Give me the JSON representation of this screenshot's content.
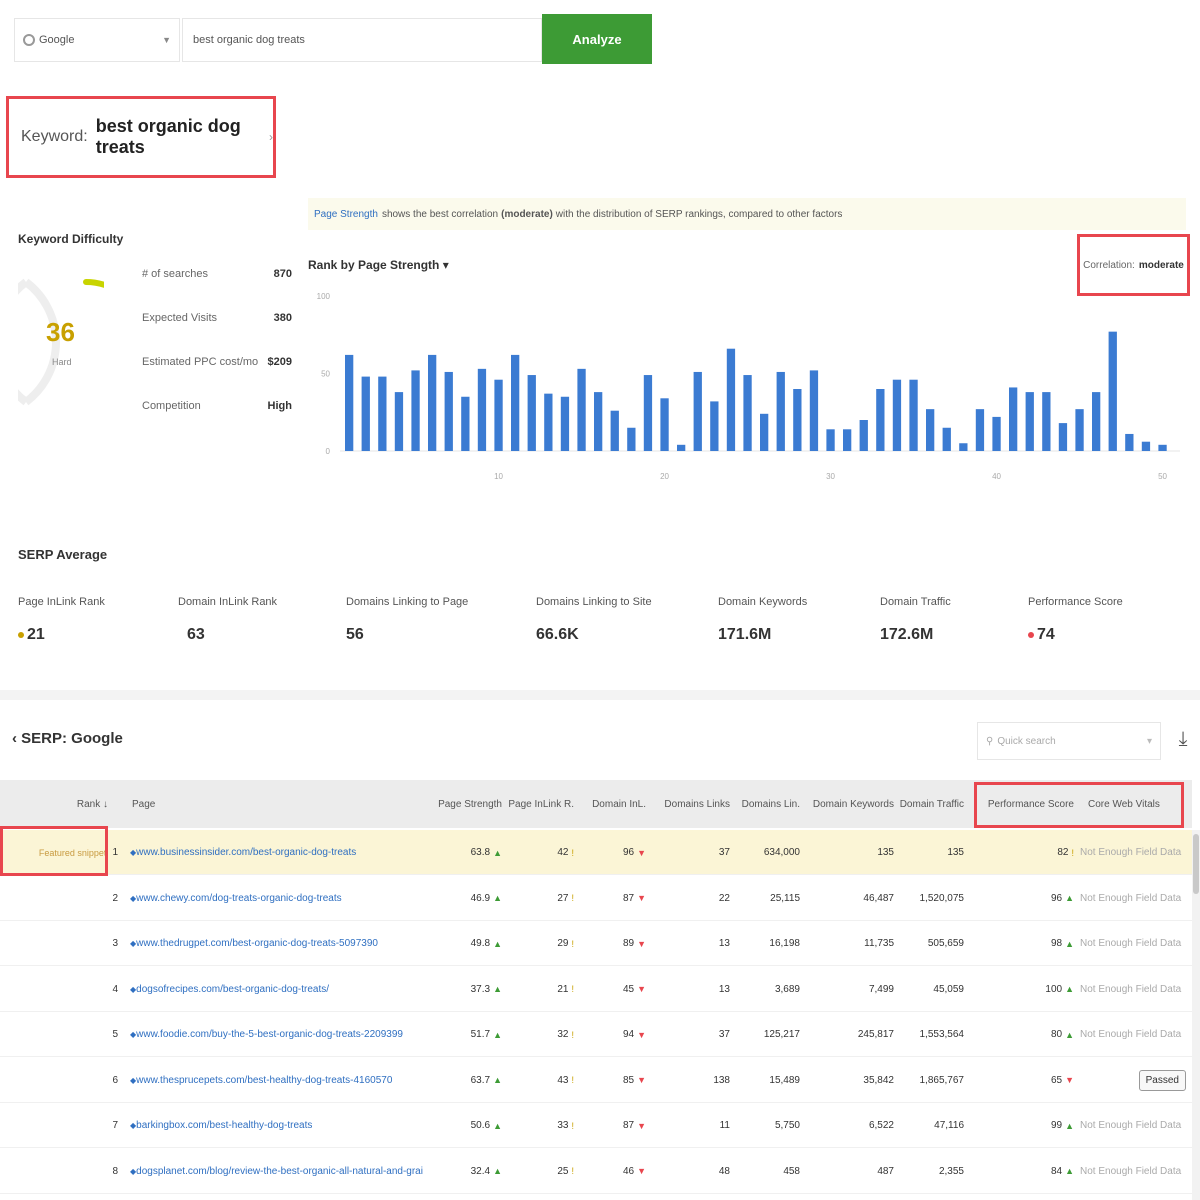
{
  "search": {
    "engine": "Google",
    "keyword_value": "best organic dog treats",
    "analyze_label": "Analyze"
  },
  "keyword": {
    "label": "Keyword:",
    "value": "best organic dog treats",
    "chevron": "›"
  },
  "difficulty": {
    "title": "Keyword Difficulty",
    "score": "36",
    "sublabel": "Hard",
    "score_fraction": 0.36,
    "metrics": [
      {
        "label": "# of searches",
        "value": "870"
      },
      {
        "label": "Expected Visits",
        "value": "380"
      },
      {
        "label": "Estimated PPC cost/mo",
        "value": "$209"
      },
      {
        "label": "Competition",
        "value": "High"
      }
    ]
  },
  "info": {
    "link": "Page Strength",
    "text_before": "shows the best correlation",
    "bold": "(moderate)",
    "text_after": "with the distribution of SERP rankings, compared to other factors"
  },
  "chart": {
    "title": "Rank by Page Strength",
    "title_caret": "▾",
    "correlation_label": "Correlation:",
    "correlation_value": "moderate"
  },
  "chart_data": {
    "type": "bar",
    "title": "Rank by Page Strength",
    "xlabel": "",
    "ylabel": "",
    "ylim": [
      0,
      100
    ],
    "yticks": [
      "100",
      "50",
      "0"
    ],
    "xticks": [
      "10",
      "20",
      "30",
      "40",
      "50"
    ],
    "bar_color": "#3b7bd2",
    "values": [
      62,
      48,
      48,
      38,
      52,
      62,
      51,
      35,
      53,
      46,
      62,
      49,
      37,
      35,
      53,
      38,
      26,
      15,
      49,
      34,
      4,
      51,
      32,
      66,
      49,
      24,
      51,
      40,
      52,
      14,
      14,
      20,
      40,
      46,
      46,
      27,
      15,
      5,
      27,
      22,
      41,
      38,
      38,
      18,
      27,
      38,
      77,
      11,
      6,
      4
    ]
  },
  "serp_average": {
    "title": "SERP Average",
    "items": [
      {
        "label": "Page InLink Rank",
        "value": "21",
        "dot": "#c8a000"
      },
      {
        "label": "Domain InLink Rank",
        "value": "63",
        "dot": ""
      },
      {
        "label": "Domains Linking to Page",
        "value": "56",
        "dot": ""
      },
      {
        "label": "Domains Linking to Site",
        "value": "66.6K",
        "dot": ""
      },
      {
        "label": "Domain Keywords",
        "value": "171.6M",
        "dot": ""
      },
      {
        "label": "Domain Traffic",
        "value": "172.6M",
        "dot": ""
      },
      {
        "label": "Performance Score",
        "value": "74",
        "dot": "#e8464e"
      }
    ]
  },
  "serp": {
    "title": "SERP: Google",
    "collapse_caret": "‹",
    "quick_search_placeholder": "Quick search",
    "columns": [
      "Rank",
      "Page",
      "Page Strength",
      "Page InLink R.",
      "Domain InL.",
      "Domains Links",
      "Domains Lin.",
      "Domain Keywords",
      "Domain Traffic",
      "Performance Score",
      "Core Web Vitals"
    ],
    "rows": [
      {
        "rank": "1",
        "rank_note": "Featured snippet",
        "page": "www.businessinsider.com/best-organic-dog-treats",
        "ps": "63.8",
        "ps_dir": "up",
        "pir": "42",
        "pir_dir": "warn",
        "dir": "96",
        "dir_dir": "down",
        "dl": "37",
        "dlin": "634,000",
        "dk": "135",
        "dt": "135",
        "perf": "82",
        "perf_dir": "warn",
        "cwv": "Not Enough Field Data",
        "cwv_type": "muted"
      },
      {
        "rank": "2",
        "rank_note": "",
        "page": "www.chewy.com/dog-treats-organic-dog-treats",
        "ps": "46.9",
        "ps_dir": "up",
        "pir": "27",
        "pir_dir": "warn",
        "dir": "87",
        "dir_dir": "down",
        "dl": "22",
        "dlin": "25,115",
        "dk": "46,487",
        "dt": "1,520,075",
        "perf": "96",
        "perf_dir": "up",
        "cwv": "Not Enough Field Data",
        "cwv_type": "muted"
      },
      {
        "rank": "3",
        "rank_note": "",
        "page": "www.thedrugpet.com/best-organic-dog-treats-5097390",
        "ps": "49.8",
        "ps_dir": "up",
        "pir": "29",
        "pir_dir": "warn",
        "dir": "89",
        "dir_dir": "down",
        "dl": "13",
        "dlin": "16,198",
        "dk": "11,735",
        "dt": "505,659",
        "perf": "98",
        "perf_dir": "up",
        "cwv": "Not Enough Field Data",
        "cwv_type": "muted"
      },
      {
        "rank": "4",
        "rank_note": "",
        "page": "dogsofrecipes.com/best-organic-dog-treats/",
        "ps": "37.3",
        "ps_dir": "up",
        "pir": "21",
        "pir_dir": "warn",
        "dir": "45",
        "dir_dir": "down",
        "dl": "13",
        "dlin": "3,689",
        "dk": "7,499",
        "dt": "45,059",
        "perf": "100",
        "perf_dir": "up",
        "cwv": "Not Enough Field Data",
        "cwv_type": "muted"
      },
      {
        "rank": "5",
        "rank_note": "",
        "page": "www.foodie.com/buy-the-5-best-organic-dog-treats-2209399",
        "ps": "51.7",
        "ps_dir": "up",
        "pir": "32",
        "pir_dir": "warn",
        "dir": "94",
        "dir_dir": "down",
        "dl": "37",
        "dlin": "125,217",
        "dk": "245,817",
        "dt": "1,553,564",
        "perf": "80",
        "perf_dir": "up",
        "cwv": "Not Enough Field Data",
        "cwv_type": "muted"
      },
      {
        "rank": "6",
        "rank_note": "",
        "page": "www.thesprucepets.com/best-healthy-dog-treats-4160570",
        "ps": "63.7",
        "ps_dir": "up",
        "pir": "43",
        "pir_dir": "warn",
        "dir": "85",
        "dir_dir": "down",
        "dl": "138",
        "dlin": "15,489",
        "dk": "35,842",
        "dt": "1,865,767",
        "perf": "65",
        "perf_dir": "down",
        "cwv": "Passed",
        "cwv_type": "passed"
      },
      {
        "rank": "7",
        "rank_note": "",
        "page": "barkingbox.com/best-healthy-dog-treats",
        "ps": "50.6",
        "ps_dir": "up",
        "pir": "33",
        "pir_dir": "warn",
        "dir": "87",
        "dir_dir": "down",
        "dl": "11",
        "dlin": "5,750",
        "dk": "6,522",
        "dt": "47,116",
        "perf": "99",
        "perf_dir": "up",
        "cwv": "Not Enough Field Data",
        "cwv_type": "muted"
      },
      {
        "rank": "8",
        "rank_note": "",
        "page": "dogsplanet.com/blog/review-the-best-organic-all-natural-and-grai",
        "ps": "32.4",
        "ps_dir": "up",
        "pir": "25",
        "pir_dir": "warn",
        "dir": "46",
        "dir_dir": "down",
        "dl": "48",
        "dlin": "458",
        "dk": "487",
        "dt": "2,355",
        "perf": "84",
        "perf_dir": "up",
        "cwv": "Not Enough Field Data",
        "cwv_type": "muted"
      }
    ]
  },
  "colors": {
    "accent_green": "#3d9b35",
    "highlight_red": "#e8464e",
    "link_blue": "#2f6fc1",
    "bar_blue": "#3b7bd2",
    "gauge_yellow": "#c8d400"
  }
}
